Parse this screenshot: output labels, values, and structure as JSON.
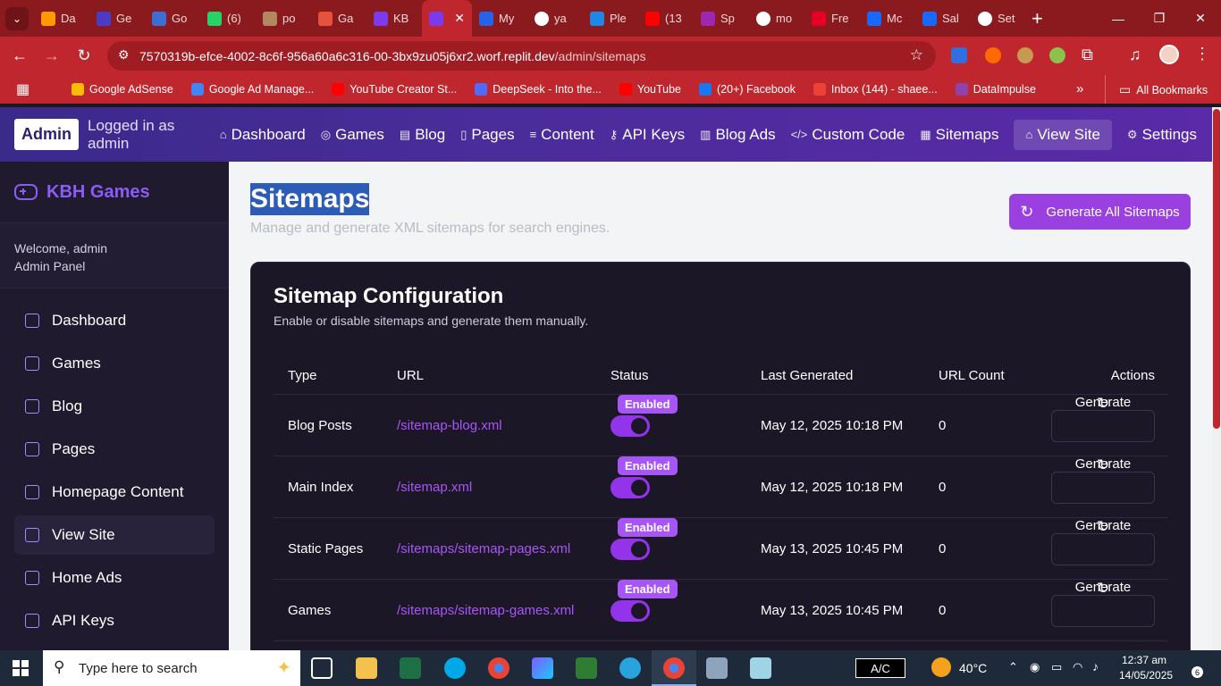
{
  "browser": {
    "tabs": [
      {
        "label": "Da",
        "icon": "amazon-icon",
        "color": "#ff9900"
      },
      {
        "label": "Ge",
        "icon": "hive-icon",
        "color": "#4b3cc7"
      },
      {
        "label": "Go",
        "icon": "shield-icon",
        "color": "#3b6fd4"
      },
      {
        "label": "(6)",
        "icon": "whatsapp-icon",
        "color": "#25d366"
      },
      {
        "label": "po",
        "icon": "avatar-icon",
        "color": "#b08a5e"
      },
      {
        "label": "Ga",
        "icon": "puzzle-icon",
        "color": "#e5533d"
      },
      {
        "label": "KB",
        "icon": "gamepad-icon",
        "color": "#7c3aed"
      },
      {
        "label": "",
        "icon": "gamepad-icon",
        "color": "#7c3aed",
        "active": true
      },
      {
        "label": "My",
        "icon": "sync-icon",
        "color": "#2563eb"
      },
      {
        "label": "ya",
        "icon": "google-icon",
        "color": "#ffffff"
      },
      {
        "label": "Ple",
        "icon": "compass-icon",
        "color": "#1e88e5"
      },
      {
        "label": "(13",
        "icon": "youtube-icon",
        "color": "#ff0000"
      },
      {
        "label": "Sp",
        "icon": "gradient-icon",
        "color": "#9c27b0"
      },
      {
        "label": "mo",
        "icon": "google-icon",
        "color": "#ffffff"
      },
      {
        "label": "Fre",
        "icon": "pinterest-icon",
        "color": "#e60023"
      },
      {
        "label": "Mc",
        "icon": "behance-icon",
        "color": "#1769ff"
      },
      {
        "label": "Sal",
        "icon": "behance-icon",
        "color": "#1769ff"
      },
      {
        "label": "Set",
        "icon": "gear-icon",
        "color": "#ffffff"
      }
    ],
    "url_host": "7570319b-efce-4002-8c6f-956a60a6c316-00-3bx9zu05j6xr2.worf.replit.dev",
    "url_path": "/admin/sitemaps",
    "bookmarks": [
      {
        "label": "Google AdSense",
        "color": "#fbbc04"
      },
      {
        "label": "Google Ad Manage...",
        "color": "#4285f4"
      },
      {
        "label": "YouTube Creator St...",
        "color": "#ff0000"
      },
      {
        "label": "DeepSeek - Into the...",
        "color": "#4d6bfe"
      },
      {
        "label": "YouTube",
        "color": "#ff0000"
      },
      {
        "label": "(20+) Facebook",
        "color": "#1877f2"
      },
      {
        "label": "Inbox (144) - shaee...",
        "color": "#ea4335"
      },
      {
        "label": "DataImpulse",
        "color": "#8e44ad"
      }
    ],
    "all_bookmarks": "All Bookmarks"
  },
  "header": {
    "badge": "Admin",
    "logged_in": "Logged in as admin",
    "nav": [
      {
        "label": "Dashboard",
        "icon": "⌂"
      },
      {
        "label": "Games",
        "icon": "◎"
      },
      {
        "label": "Blog",
        "icon": "▤"
      },
      {
        "label": "Pages",
        "icon": "▯"
      },
      {
        "label": "Content",
        "icon": "≡"
      },
      {
        "label": "API Keys",
        "icon": "⚷"
      },
      {
        "label": "Blog Ads",
        "icon": "▥"
      },
      {
        "label": "Custom Code",
        "icon": "</>"
      },
      {
        "label": "Sitemaps",
        "icon": "▦"
      },
      {
        "label": "View Site",
        "icon": "⌂"
      },
      {
        "label": "Settings",
        "icon": "⚙"
      }
    ]
  },
  "sidebar": {
    "brand": "KBH Games",
    "welcome": "Welcome, admin",
    "role": "Admin Panel",
    "items": [
      "Dashboard",
      "Games",
      "Blog",
      "Pages",
      "Homepage Content",
      "View Site",
      "Home Ads",
      "API Keys"
    ]
  },
  "main": {
    "title": "Sitemaps",
    "subtitle": "Manage and generate XML sitemaps for search engines.",
    "generate_all": "Generate All Sitemaps",
    "card": {
      "title": "Sitemap Configuration",
      "description": "Enable or disable sitemaps and generate them manually.",
      "columns": [
        "Type",
        "URL",
        "Status",
        "Last Generated",
        "URL Count",
        "Actions"
      ],
      "rows": [
        {
          "type": "Blog Posts",
          "url": "/sitemap-blog.xml",
          "status": "Enabled",
          "last": "May 12, 2025 10:18 PM",
          "count": "0",
          "action": "Generate"
        },
        {
          "type": "Main Index",
          "url": "/sitemap.xml",
          "status": "Enabled",
          "last": "May 12, 2025 10:18 PM",
          "count": "0",
          "action": "Generate"
        },
        {
          "type": "Static Pages",
          "url": "/sitemaps/sitemap-pages.xml",
          "status": "Enabled",
          "last": "May 13, 2025 10:45 PM",
          "count": "0",
          "action": "Generate"
        },
        {
          "type": "Games",
          "url": "/sitemaps/sitemap-games.xml",
          "status": "Enabled",
          "last": "May 13, 2025 10:45 PM",
          "count": "0",
          "action": "Generate"
        }
      ]
    }
  },
  "taskbar": {
    "search_placeholder": "Type here to search",
    "ac": "A/C",
    "temperature": "40°C",
    "time": "12:37 am",
    "date": "14/05/2025",
    "notifications": "6"
  }
}
